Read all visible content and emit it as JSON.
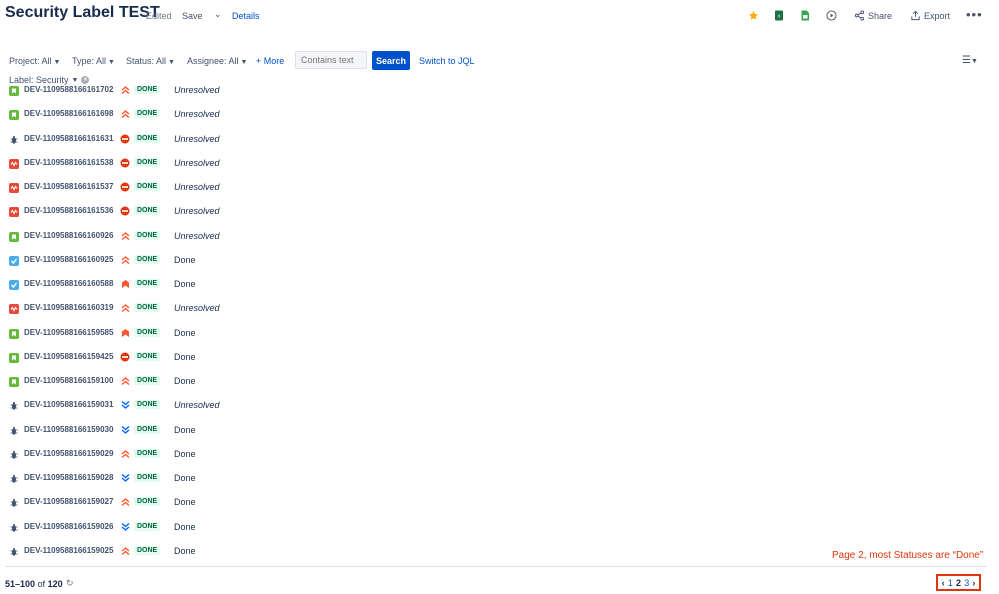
{
  "header": {
    "title": "Security Label TEST",
    "edited": "Edited",
    "save": "Save",
    "details": "Details",
    "share": "Share",
    "export": "Export"
  },
  "filters": {
    "project": "Project: All",
    "type": "Type: All",
    "status": "Status: All",
    "assignee": "Assignee: All",
    "more": "+ More",
    "search_placeholder": "Contains text",
    "search_button": "Search",
    "switch_jql": "Switch to JQL",
    "label": "Label: Security"
  },
  "rows": [
    {
      "key": "DEV-1109588166161702",
      "type": "story",
      "priority": "highest",
      "status": "DONE",
      "resolution": "Unresolved"
    },
    {
      "key": "DEV-1109588166161698",
      "type": "story",
      "priority": "highest",
      "status": "DONE",
      "resolution": "Unresolved"
    },
    {
      "key": "DEV-1109588166161631",
      "type": "bug",
      "priority": "blocker",
      "status": "DONE",
      "resolution": "Unresolved"
    },
    {
      "key": "DEV-1109588166161538",
      "type": "incident",
      "priority": "blocker",
      "status": "DONE",
      "resolution": "Unresolved"
    },
    {
      "key": "DEV-1109588166161537",
      "type": "incident",
      "priority": "blocker",
      "status": "DONE",
      "resolution": "Unresolved"
    },
    {
      "key": "DEV-1109588166161536",
      "type": "incident",
      "priority": "blocker",
      "status": "DONE",
      "resolution": "Unresolved"
    },
    {
      "key": "DEV-1109588166160926",
      "type": "story",
      "priority": "highest",
      "status": "DONE",
      "resolution": "Unresolved"
    },
    {
      "key": "DEV-1109588166160925",
      "type": "task",
      "priority": "highest",
      "status": "DONE",
      "resolution": "Done"
    },
    {
      "key": "DEV-1109588166160588",
      "type": "task",
      "priority": "critical",
      "status": "DONE",
      "resolution": "Done"
    },
    {
      "key": "DEV-1109588166160319",
      "type": "incident",
      "priority": "highest",
      "status": "DONE",
      "resolution": "Unresolved"
    },
    {
      "key": "DEV-1109588166159585",
      "type": "story",
      "priority": "critical",
      "status": "DONE",
      "resolution": "Done"
    },
    {
      "key": "DEV-1109588166159425",
      "type": "story",
      "priority": "blocker",
      "status": "DONE",
      "resolution": "Done"
    },
    {
      "key": "DEV-1109588166159100",
      "type": "story",
      "priority": "highest",
      "status": "DONE",
      "resolution": "Done"
    },
    {
      "key": "DEV-1109588166159031",
      "type": "bug",
      "priority": "lowest",
      "status": "DONE",
      "resolution": "Unresolved"
    },
    {
      "key": "DEV-1109588166159030",
      "type": "bug",
      "priority": "lowest",
      "status": "DONE",
      "resolution": "Done"
    },
    {
      "key": "DEV-1109588166159029",
      "type": "bug",
      "priority": "highest",
      "status": "DONE",
      "resolution": "Done"
    },
    {
      "key": "DEV-1109588166159028",
      "type": "bug",
      "priority": "lowest",
      "status": "DONE",
      "resolution": "Done"
    },
    {
      "key": "DEV-1109588166159027",
      "type": "bug",
      "priority": "highest",
      "status": "DONE",
      "resolution": "Done"
    },
    {
      "key": "DEV-1109588166159026",
      "type": "bug",
      "priority": "lowest",
      "status": "DONE",
      "resolution": "Done"
    },
    {
      "key": "DEV-1109588166159025",
      "type": "bug",
      "priority": "highest",
      "status": "DONE",
      "resolution": "Done"
    }
  ],
  "footer": {
    "range": "51–100",
    "of": "of",
    "total": "120",
    "annotation": "Page 2, most Statuses are “Done”",
    "pages": [
      "1",
      "2",
      "3"
    ],
    "current_page": "2"
  },
  "colors": {
    "accent": "#0052cc",
    "done_bg": "#e3fcef",
    "done_fg": "#006644",
    "annotation": "#de350b"
  }
}
